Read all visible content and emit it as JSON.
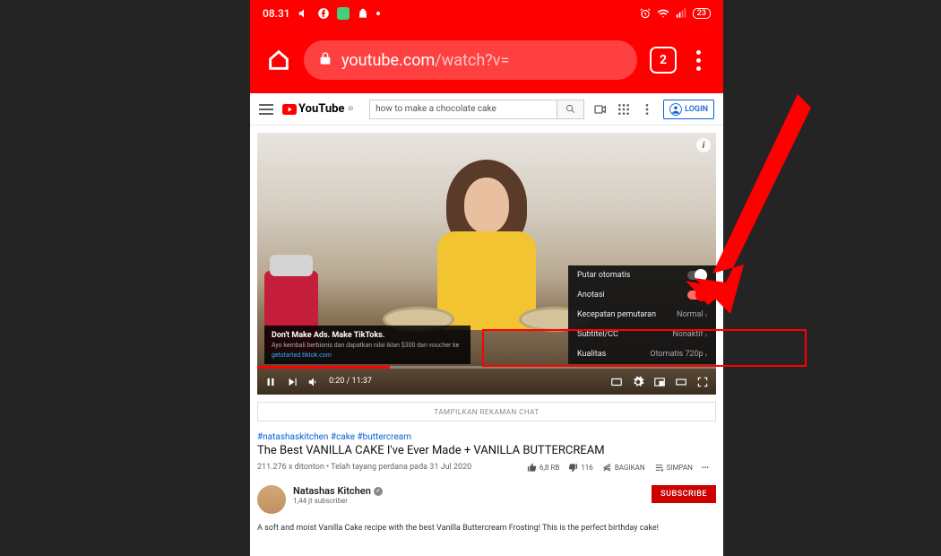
{
  "status": {
    "time": "08.31",
    "battery": "23"
  },
  "url": {
    "host": "youtube.com",
    "path": "/watch?v="
  },
  "tabcount": "2",
  "yt": {
    "brand": "YouTube",
    "region": "ID",
    "search": "how to make a chocolate cake",
    "login": "LOGIN"
  },
  "player": {
    "ad": {
      "title": "Don't Make Ads. Make TikToks.",
      "subtitle": "Ayo kembali berbisnis dan dapatkan nilai iklan $300 dan voucher ke",
      "link": "getstarted.tiktok.com"
    },
    "menu": {
      "row1": "Putar otomatis",
      "row2": "Anotasi",
      "row3": {
        "label": "Kecepatan pemutaran",
        "value": "Normal"
      },
      "row4": {
        "label": "Subtitel/CC",
        "value": "Nonaktif"
      },
      "row5": {
        "label": "Kualitas",
        "value": "Otomatis 720p"
      }
    },
    "time": "0:20 / 11:37"
  },
  "chat_label": "TAMPILKAN REKAMAN CHAT",
  "video": {
    "tags": "#natashaskitchen #cake #buttercream",
    "title": "The Best VANILLA CAKE I've Ever Made + VANILLA BUTTERCREAM",
    "stats": "211.276 x ditonton • Telah tayang perdana pada 31 Jul 2020",
    "likes": "6,8 RB",
    "dislikes": "116",
    "share": "BAGIKAN",
    "save": "SIMPAN"
  },
  "channel": {
    "name": "Natashas Kitchen",
    "subs": "1,44 jt subscriber",
    "btn": "SUBSCRIBE"
  },
  "desc": "A soft and moist Vanilla Cake recipe with the best Vanilla Buttercream Frosting! This is the perfect birthday cake!"
}
